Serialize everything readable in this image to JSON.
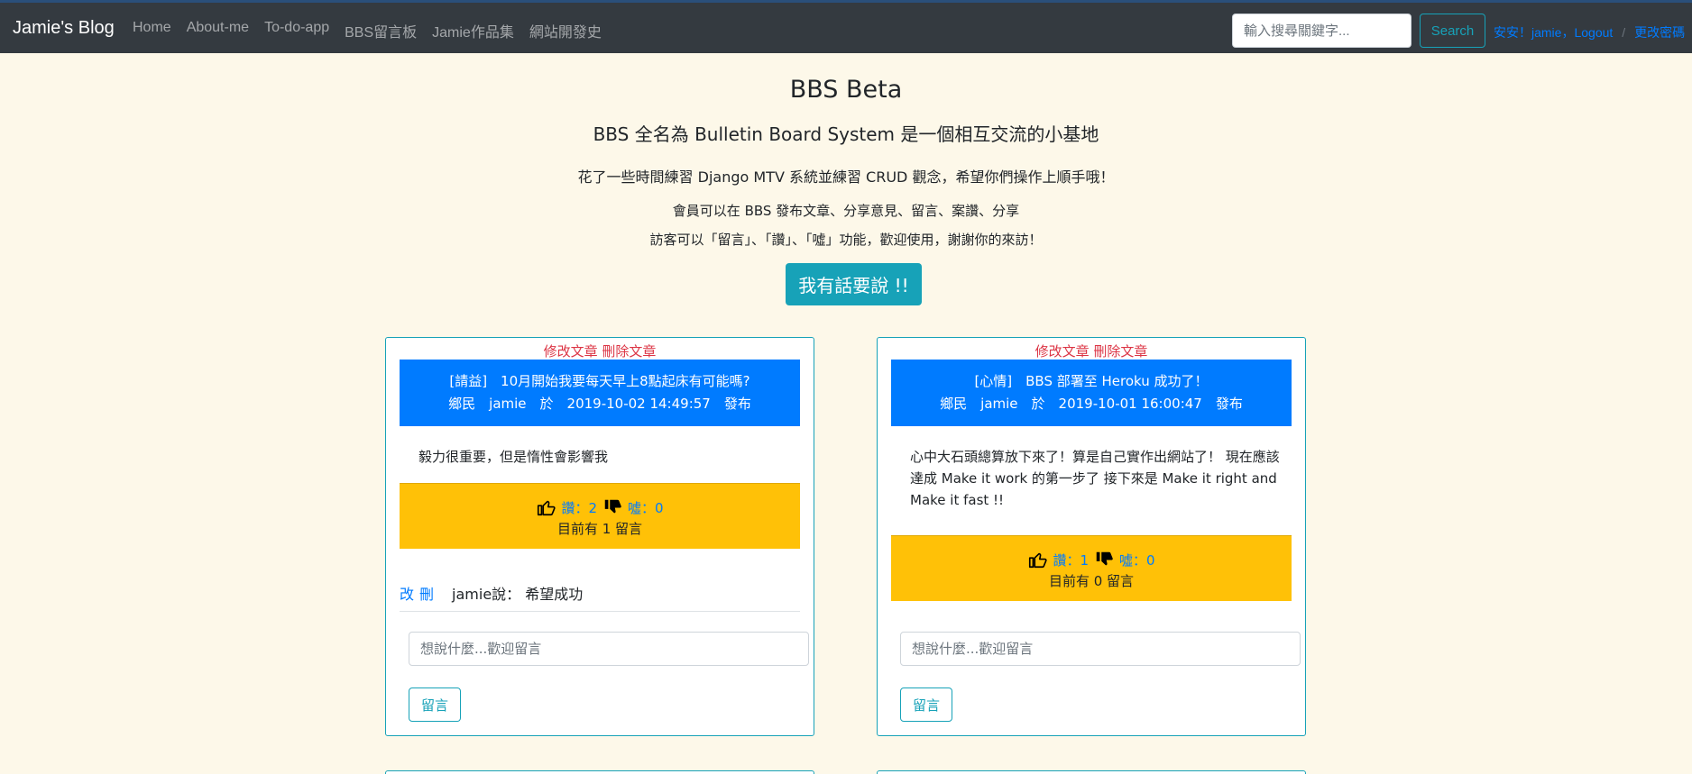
{
  "navbar": {
    "brand": "Jamie's Blog",
    "links": [
      "Home",
      "About-me",
      "To-do-app",
      "BBS留言板",
      "Jamie作品集",
      "網站開發史"
    ],
    "search": {
      "placeholder": "輸入搜尋關鍵字...",
      "button": "Search"
    },
    "greeting": "安安！jamie，Logout",
    "separator": "/",
    "change_password": "更改密碼"
  },
  "hero": {
    "title": "BBS Beta",
    "subtitle": "BBS 全名為 Bulletin Board System 是一個相互交流的小基地",
    "line1": "花了一些時間練習 Django MTV 系統並練習 CRUD 觀念，希望你們操作上順手哦！",
    "line2": "會員可以在 BBS 發布文章、分享意見、留言、案讚、分享",
    "line3": "訪客可以「留言」、「讚」、「噓」功能，歡迎使用，謝謝你的來訪！",
    "button": "我有話要說 !!"
  },
  "posts": [
    {
      "edit_label": "修改文章",
      "delete_label": "刪除文章",
      "title": "[請益]　10月開始我要每天早上8點起床有可能嗎?",
      "meta": "鄉民　jamie　於　2019-10-02 14:49:57　發布",
      "body": "毅力很重要，但是惰性會影響我",
      "like_text": "讚：2",
      "dislike_text": "噓：0",
      "comment_count_text": "目前有 1 留言",
      "comments": [
        {
          "edit": "改",
          "delete": "刪",
          "text": "jamie說：  希望成功"
        }
      ],
      "comment_placeholder": "想說什麼...歡迎留言",
      "comment_button": "留言"
    },
    {
      "edit_label": "修改文章",
      "delete_label": "刪除文章",
      "title": "[心情]　BBS 部署至 Heroku 成功了！",
      "meta": "鄉民　jamie　於　2019-10-01 16:00:47　發布",
      "body": "心中大石頭總算放下來了！算是自己實作出網站了！ 現在應該達成 Make it work 的第一步了 接下來是 Make it right and Make it fast !!",
      "like_text": "讚：1",
      "dislike_text": "噓：0",
      "comment_count_text": "目前有 0 留言",
      "comments": [],
      "comment_placeholder": "想說什麼...歡迎留言",
      "comment_button": "留言"
    }
  ],
  "colors": {
    "page_bg": "#fdf8e9",
    "navbar_bg": "#343a40",
    "header_blue": "#007bff",
    "vote_yellow": "#ffc107",
    "accent_teal": "#17a2b8",
    "danger_red": "#dc3545"
  },
  "icons": {
    "like": "thumbs-up-icon",
    "dislike": "thumbs-down-icon"
  }
}
